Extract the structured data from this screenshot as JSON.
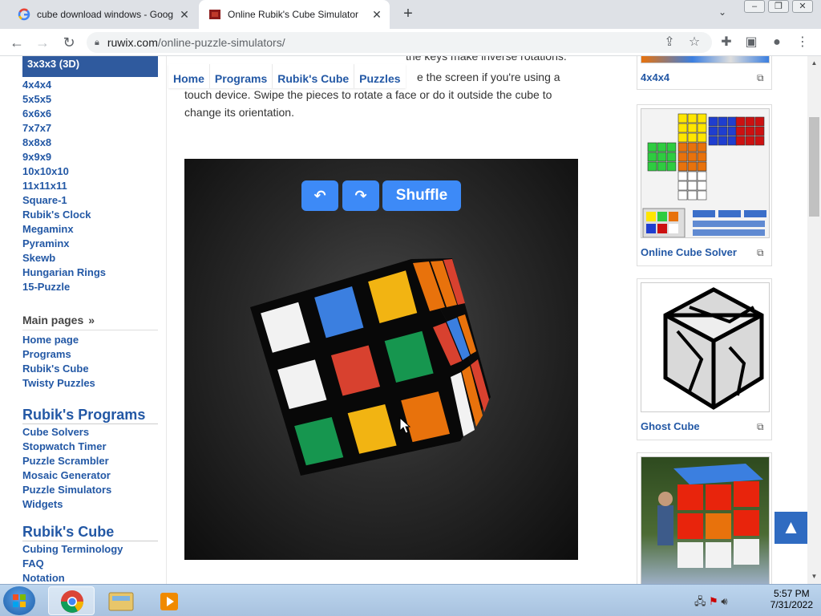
{
  "browser": {
    "tabs": [
      {
        "title": "cube download windows - Goog",
        "favicon": "google-g-icon"
      },
      {
        "title": "Online Rubik's Cube Simulator",
        "favicon": "ruwix-icon"
      }
    ],
    "url_domain": "ruwix.com",
    "url_path": "/online-puzzle-simulators/"
  },
  "sidebar": {
    "active_item": "3x3x3 (3D)",
    "puzzle_links": [
      "4x4x4",
      "5x5x5",
      "6x6x6",
      "7x7x7",
      "8x8x8",
      "9x9x9",
      "10x10x10",
      "11x11x11",
      "Square-1",
      "Rubik's Clock",
      "Megaminx",
      "Pyraminx",
      "Skewb",
      "Hungarian Rings",
      "15-Puzzle"
    ],
    "main_pages_heading": "Main pages",
    "main_pages_raquo": "»",
    "main_pages": [
      "Home page",
      "Programs",
      "Rubik's Cube",
      "Twisty Puzzles"
    ],
    "programs_heading": "Rubik's Programs",
    "programs": [
      "Cube Solvers",
      "Stopwatch Timer",
      "Puzzle Scrambler",
      "Mosaic Generator",
      "Puzzle Simulators",
      "Widgets"
    ],
    "cube_heading": "Rubik's Cube",
    "cube_links": [
      "Cubing Terminology",
      "FAQ",
      "Notation"
    ]
  },
  "breadcrumb": [
    "Home",
    "Programs",
    "Rubik's Cube",
    "Puzzles"
  ],
  "content": {
    "cut_line": "the keys make inverse rotations.",
    "para_line1": "e the screen if you're using a",
    "para_line2": "touch device. Swipe the pieces to rotate a face or do it outside the cube to",
    "para_line3": "change its orientation."
  },
  "simulator": {
    "undo_label": "↶",
    "redo_label": "↷",
    "shuffle_label": "Shuffle",
    "front_face_colors": [
      [
        "#f2f2f2",
        "#3b7fe0",
        "#f2b412"
      ],
      [
        "#f2f2f2",
        "#d8412f",
        "#16964f"
      ],
      [
        "#16964f",
        "#f2b412",
        "#e8720c"
      ]
    ]
  },
  "right_cards": [
    {
      "label": "4x4x4"
    },
    {
      "label": "Online Cube Solver"
    },
    {
      "label": "Ghost Cube"
    },
    {
      "label": ""
    }
  ],
  "taskbar": {
    "time": "5:57 PM",
    "date": "7/31/2022"
  }
}
